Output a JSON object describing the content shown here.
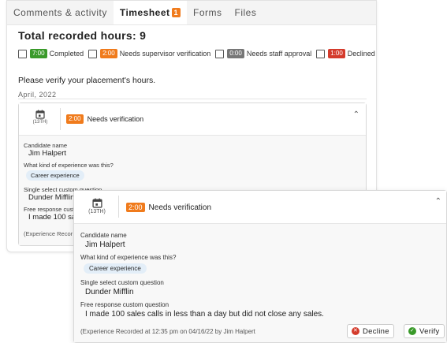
{
  "tabs": [
    {
      "label": "Comments & activity"
    },
    {
      "label": "Timesheet",
      "count": "1"
    },
    {
      "label": "Forms"
    },
    {
      "label": "Files"
    }
  ],
  "title": "Total recorded hours: 9",
  "legend": [
    {
      "badge": "7:00",
      "label": "Completed",
      "color": "#3a9a2a"
    },
    {
      "badge": "2:00",
      "label": "Needs supervisor verification",
      "color": "#f07b1c"
    },
    {
      "badge": "0:00",
      "label": "Needs staff approval",
      "color": "#777777"
    },
    {
      "badge": "1:00",
      "label": "Declined",
      "color": "#d43b2c"
    }
  ],
  "verify_text": "Please verify your placement's hours.",
  "month": "April, 2022",
  "entry": {
    "day": "(13TH)",
    "badge": "2:00",
    "status": "Needs verification",
    "candidate_label": "Candidate name",
    "candidate": "Jim Halpert",
    "kind_label": "What kind of experience was this?",
    "kind": "Career experience",
    "select_label": "Single select custom question",
    "select_value": "Dunder Mifflin",
    "free_label": "Free response custom question",
    "free_value": "I made 100 sales calls in less than a day but did not close any sales.",
    "free_value_clipped": "I made 100 sale",
    "free_label_clipped": "Free response cust",
    "recorded_clipped": "(Experience Recor",
    "recorded": "(Experience Recorded at 12:35 pm on 04/16/22 by Jim Halpert"
  },
  "actions": {
    "decline": "Decline",
    "verify": "Verify"
  },
  "colors": {
    "accent_orange": "#f07b1c",
    "decline_red": "#d43b2c",
    "verify_green": "#3a9a2a",
    "chip_bg": "#e3eef8"
  }
}
